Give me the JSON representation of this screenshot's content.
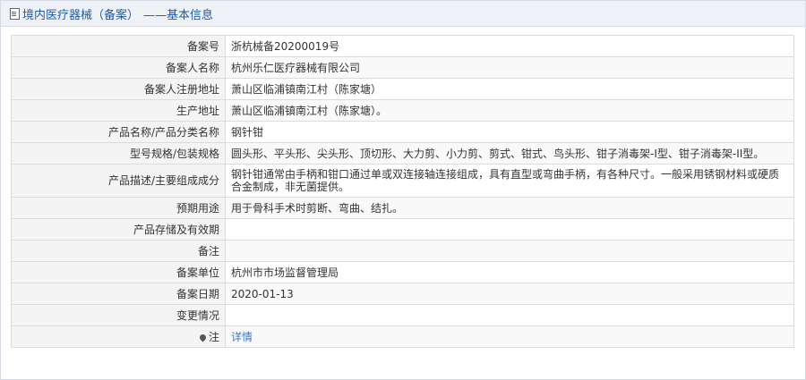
{
  "header": {
    "title": "境内医疗器械（备案）",
    "subtitle": "——基本信息"
  },
  "rows": [
    {
      "label": "备案号",
      "value": "浙杭械备20200019号"
    },
    {
      "label": "备案人名称",
      "value": "杭州乐仁医疗器械有限公司"
    },
    {
      "label": "备案人注册地址",
      "value": "萧山区临浦镇南江村（陈家塘）"
    },
    {
      "label": "生产地址",
      "value": "萧山区临浦镇南江村（陈家塘）。"
    },
    {
      "label": "产品名称/产品分类名称",
      "value": "钢针钳"
    },
    {
      "label": "型号规格/包装规格",
      "value": "圆头形、平头形、尖头形、顶切形、大力剪、小力剪、剪式、钳式、鸟头形、钳子消毒架-I型、钳子消毒架-II型。"
    },
    {
      "label": "产品描述/主要组成成分",
      "value": "钢针钳通常由手柄和钳口通过单或双连接轴连接组成，具有直型或弯曲手柄，有各种尺寸。一般采用锈钢材料或硬质合金制成，非无菌提供。"
    },
    {
      "label": "预期用途",
      "value": "用于骨科手术时剪断、弯曲、结扎。"
    },
    {
      "label": "产品存储及有效期",
      "value": ""
    },
    {
      "label": "备注",
      "value": ""
    },
    {
      "label": "备案单位",
      "value": "杭州市市场监督管理局"
    },
    {
      "label": "备案日期",
      "value": "2020-01-13"
    },
    {
      "label": "变更情况",
      "value": ""
    },
    {
      "label": "注",
      "value": "详情"
    }
  ]
}
